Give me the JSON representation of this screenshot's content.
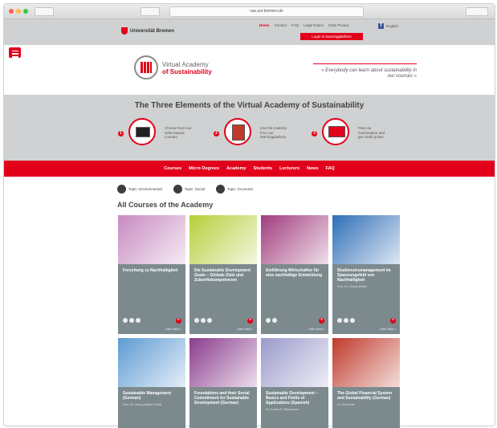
{
  "browser": {
    "url": "vas.uni-bremen.de",
    "colors": {
      "close": "#fc605b",
      "minimize": "#fdbc40",
      "maximize": "#34c84a"
    }
  },
  "topbar": {
    "university": "Universität Bremen",
    "links": [
      "Home",
      "Contact",
      "FAQ",
      "Legal Notice",
      "Data Privacy"
    ],
    "language": "English",
    "login_button": "Login to learningplatform"
  },
  "header": {
    "logo_line1": "Virtual Academy",
    "logo_line2": "of Sustainability",
    "quote": "« Everybody can learn about sustainability in our courses »"
  },
  "elements": {
    "title": "The Three Elements of the Virtual Academy of Sustainability",
    "steps": [
      {
        "num": "1",
        "text": "Choose from our video-based courses",
        "icon": "laptop-icon"
      },
      {
        "num": "2",
        "text": "Use the material from our learningplatform",
        "icon": "tablet-icon"
      },
      {
        "num": "3",
        "text": "Pass an examination and get credit points",
        "icon": "monitor-icon"
      }
    ]
  },
  "nav": {
    "items": [
      "Courses",
      "Micro Degrees",
      "Academy",
      "Students",
      "Lecturers",
      "News",
      "FAQ"
    ]
  },
  "topics": [
    {
      "label": "Topic: Environmental",
      "icon": "environment-icon"
    },
    {
      "label": "Topic: Social",
      "icon": "social-icon"
    },
    {
      "label": "Topic: Economic",
      "icon": "economic-icon"
    }
  ],
  "courses_title": "All Courses of the Academy",
  "courses": [
    {
      "title": "Forschung zu Nachhaltigkeit",
      "sub": "",
      "more": "mehr Infos »",
      "color": "#c78ac0"
    },
    {
      "title": "Die Sustainable Development Goals – Globale Ziele und Zukunftskompetenzen",
      "sub": "",
      "more": "mehr Infos »",
      "color": "#b6cf3a"
    },
    {
      "title": "Einführung Wirtschaften für eine nachhaltige Entwicklung",
      "sub": "",
      "more": "mehr Infos »",
      "color": "#a03c7d"
    },
    {
      "title": "Studienumsmanagement im Spannungsfeld von Nachhaltigkeit",
      "sub": "Prof. Dr. Georg Müller",
      "more": "mehr Infos »",
      "color": "#2f6fb6"
    },
    {
      "title": "Sustainable Management (German)",
      "sub": "Prof. Dr. Georg Müller-Christ",
      "more": "",
      "color": "#5d9bd3"
    },
    {
      "title": "Foundations and their Social Commitment for Sustainable Development (German)",
      "sub": "",
      "more": "",
      "color": "#8b3c8e"
    },
    {
      "title": "Sustainable Development – Basics and Fields of Applications (Spanish)",
      "sub": "Dr. Carlos R. Bohórquez",
      "more": "",
      "color": "#9a9acb"
    },
    {
      "title": "The Global Financial System and Sustainability (German)",
      "sub": "Dr. Dirk Dutz",
      "more": "",
      "color": "#c0392b"
    }
  ]
}
